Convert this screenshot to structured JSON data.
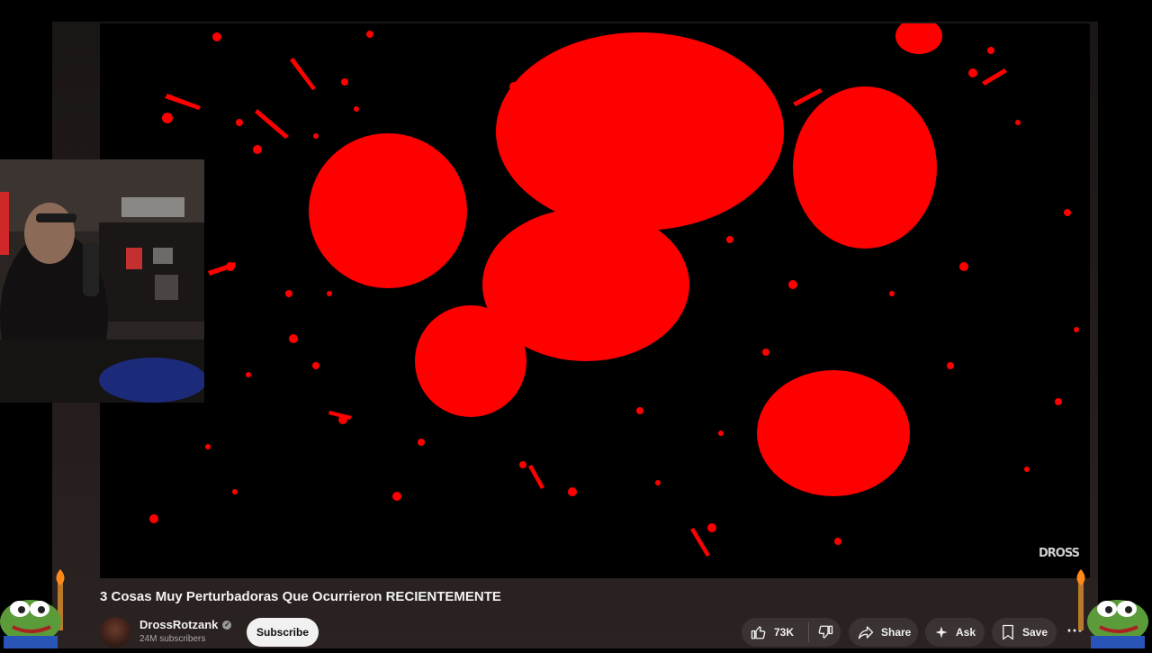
{
  "video": {
    "title": "3 Cosas Muy Perturbadoras Que Ocurrieron RECIENTEMENTE",
    "watermark": "DROSS",
    "background_color": "#000000",
    "splatter_color": "#ff0000"
  },
  "channel": {
    "name": "DrossRotzank",
    "subscribers": "24M subscribers",
    "verified_icon": "verified-check-icon"
  },
  "actions": {
    "subscribe_label": "Subscribe",
    "like_count": "73K",
    "share_label": "Share",
    "ask_label": "Ask",
    "save_label": "Save",
    "more_icon": "more-horizontal-icon"
  },
  "overlays": {
    "webcam": "streamer-webcam",
    "left_decoration": "frog-torch-emote",
    "right_decoration": "frog-torch-emote"
  }
}
